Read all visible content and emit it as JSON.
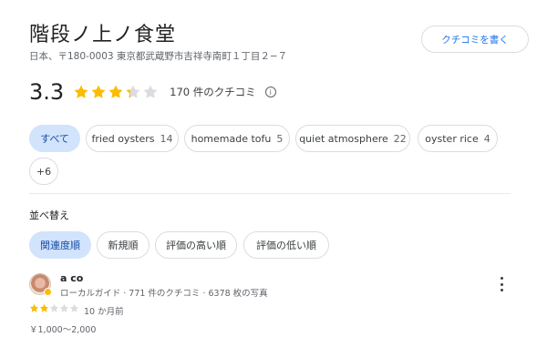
{
  "place": {
    "name": "階段ノ上ノ食堂",
    "address": "日本、〒180-0003 東京都武蔵野市吉祥寺南町１丁目２−７",
    "write_review_label": "クチコミを書く"
  },
  "rating": {
    "value": "3.3",
    "stars_filled": 3.3,
    "star_color": "#fbbc04",
    "star_empty_color": "#dadce0",
    "review_count": "170 件のクチコミ",
    "info_glyph": "i"
  },
  "topics": [
    {
      "label": "すべて",
      "count": "",
      "active": true
    },
    {
      "label": "fried oysters",
      "count": "14",
      "active": false
    },
    {
      "label": "homemade tofu",
      "count": "5",
      "active": false
    },
    {
      "label": "quiet atmosphere",
      "count": "22",
      "active": false
    },
    {
      "label": "oyster rice",
      "count": "4",
      "active": false
    },
    {
      "label": "+6",
      "count": "",
      "active": false
    }
  ],
  "sort": {
    "label": "並べ替え",
    "options": [
      {
        "label": "関連度順",
        "active": true
      },
      {
        "label": "新規順",
        "active": false
      },
      {
        "label": "評価の高い順",
        "active": false
      },
      {
        "label": "評価の低い順",
        "active": false
      }
    ]
  },
  "review": {
    "author": "a co",
    "meta": "ローカルガイド · 771 件のクチコミ · 6378 枚の写真",
    "stars": 2,
    "age": "10 か月前",
    "price": "￥1,000〜2,000"
  },
  "colors": {
    "accent": "#1a73e8",
    "chip_active_bg": "#d2e3fc",
    "chip_active_text": "#174ea6"
  }
}
